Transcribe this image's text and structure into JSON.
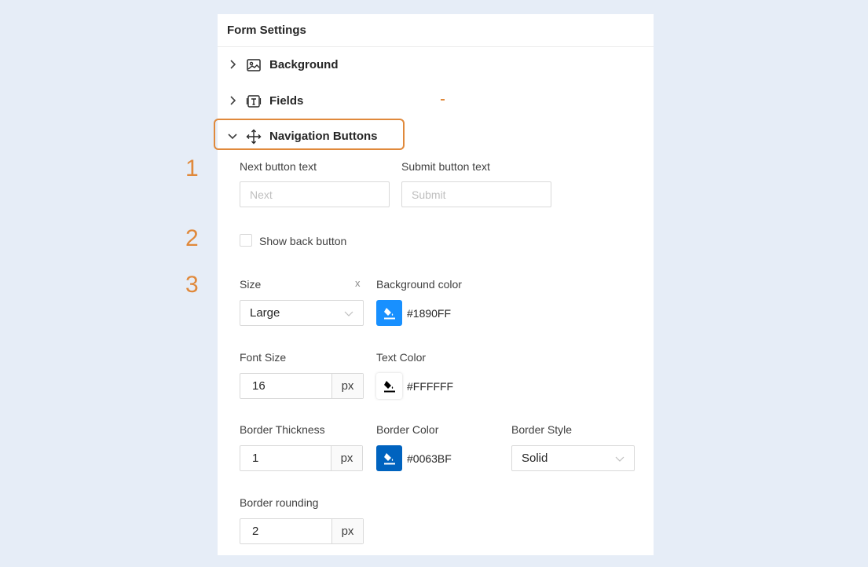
{
  "panel": {
    "title": "Form Settings"
  },
  "sections": [
    {
      "label": "Background",
      "icon": "image-icon",
      "expanded": false
    },
    {
      "label": "Fields",
      "icon": "text-field-icon",
      "expanded": false
    },
    {
      "label": "Navigation Buttons",
      "icon": "move-arrows-icon",
      "expanded": true
    }
  ],
  "markers": [
    "1",
    "2",
    "3"
  ],
  "next_button": {
    "label": "Next button text",
    "placeholder": "Next"
  },
  "submit_button": {
    "label": "Submit button text",
    "placeholder": "Submit"
  },
  "show_back": {
    "label": "Show back button",
    "checked": false
  },
  "size": {
    "label": "Size",
    "value": "Large",
    "clear": "x"
  },
  "background_color": {
    "label": "Background color",
    "value": "#1890FF"
  },
  "font_size": {
    "label": "Font Size",
    "value": "16",
    "unit": "px"
  },
  "text_color": {
    "label": "Text Color",
    "value": "#FFFFFF"
  },
  "border_thickness": {
    "label": "Border Thickness",
    "value": "1",
    "unit": "px"
  },
  "border_color": {
    "label": "Border Color",
    "value": "#0063BF"
  },
  "border_style": {
    "label": "Border Style",
    "value": "Solid"
  },
  "border_rounding": {
    "label": "Border rounding",
    "value": "2",
    "unit": "px"
  },
  "colors": {
    "accent": "#e0893b",
    "swatch_bg": "#1890FF",
    "swatch_text": "#FFFFFF",
    "swatch_border": "#0063BF"
  }
}
